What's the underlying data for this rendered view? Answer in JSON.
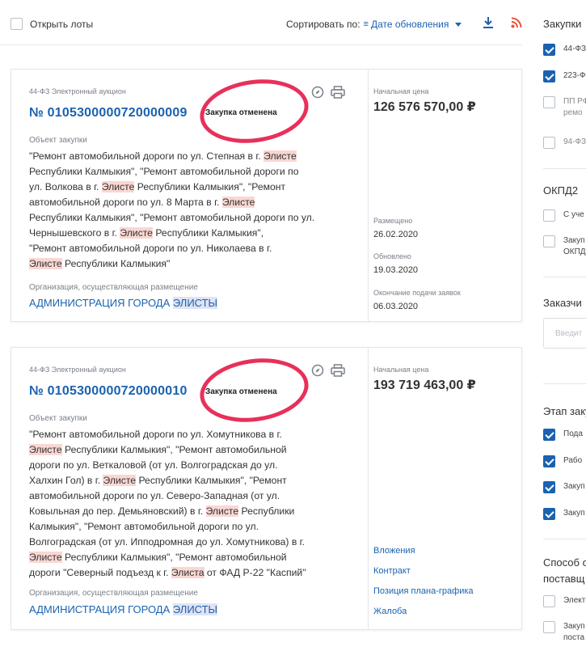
{
  "toolbar": {
    "open_lots": "Открыть лоты",
    "sort_label": "Сортировать по:",
    "sort_value": "Дате обновления",
    "download_icon": "download-icon",
    "rss_icon": "rss-icon"
  },
  "cards": [
    {
      "type": "44-ФЗ Электронный аукцион",
      "number": "№ 0105300000720000009",
      "status": "Закупка отменена",
      "object_label": "Объект закупки",
      "object_parts": [
        "\"Ремонт  автомобильной дороги по ул. Степная в г. ",
        "Элисте",
        "",
        "Республики Калмыкия\", \"Ремонт автомобильной дороги по",
        "",
        "",
        "ул. Волкова в г. ",
        "Элисте",
        " Республики Калмыкия\", \"Ремонт",
        "автомобильной дороги по ул. 8 Марта в г. ",
        "Элисте",
        "",
        "Республики Калмыкия\", \"Ремонт автомобильной дороги по ул.",
        "",
        "",
        "Чернышевского в г. ",
        "Элисте",
        " Республики Калмыкия\",",
        "\"Ремонт автомобильной дороги по ул. Николаева в г.",
        "",
        "",
        "",
        "Элисте",
        " Республики Калмыкия\""
      ],
      "org_label": "Организация, осуществляющая размещение",
      "org_prefix": "АДМИНИСТРАЦИЯ ГОРОДА ",
      "org_hl": "ЭЛИСТЫ",
      "price_label": "Начальная цена",
      "price": "126 576 570,00 ₽",
      "placed_label": "Размещено",
      "placed": "26.02.2020",
      "updated_label": "Обновлено",
      "updated": "19.03.2020",
      "deadline_label": "Окончание подачи заявок",
      "deadline": "06.03.2020"
    },
    {
      "type": "44-ФЗ Электронный аукцион",
      "number": "№ 0105300000720000010",
      "status": "Закупка отменена",
      "object_label": "Объект закупки",
      "object_parts": [
        "\"Ремонт автомобильной дороги по ул. Хомутникова в г.",
        "",
        "",
        "",
        "Элисте",
        " Республики Калмыкия\", \"Ремонт автомобильной",
        "дороги по ул. Веткаловой (от ул. Волгоградская до ул.",
        "",
        "",
        "Халхин Гол) в г. ",
        "Элисте",
        " Республики Калмыкия\", \"Ремонт",
        "автомобильной дороги по ул. Северо-Западная (от ул.",
        "",
        "",
        "Ковыльная до пер. Демьяновский) в г. ",
        "Элисте",
        " Республики",
        "Калмыкия\", \"Ремонт автомобильной дороги по ул.",
        "",
        "",
        "Волгоградская (от ул. Ипподромная до ул. Хомутникова) в г.",
        "",
        "",
        "",
        "Элисте",
        " Республики Калмыкия\", \"Ремонт автомобильной",
        "дороги \"Северный подъезд к г. ",
        "Элиста",
        " от ФАД Р-22 \"Каспий\""
      ],
      "org_label": "Организация, осуществляющая размещение",
      "org_prefix": "АДМИНИСТРАЦИЯ ГОРОДА ",
      "org_hl": "ЭЛИСТЫ",
      "price_label": "Начальная цена",
      "price": "193 719 463,00 ₽",
      "links": [
        "Вложения",
        "Контракт",
        "Позиция плана-графика",
        "Жалоба"
      ]
    }
  ],
  "filters": {
    "purchases_title": "Закупки",
    "purchases_items": [
      {
        "label": "44-ФЗ",
        "checked": true
      },
      {
        "label": "223-Ф",
        "checked": true
      },
      {
        "label": "ПП РФ",
        "line2": "ремо",
        "checked": false
      },
      {
        "label": "94-ФЗ",
        "checked": false
      }
    ],
    "okpd_title": "ОКПД2",
    "okpd_items": [
      {
        "label": "С уче",
        "checked": false
      },
      {
        "label": "Закуп",
        "line2": "ОКПД",
        "checked": false
      }
    ],
    "customer_title": "Заказчи",
    "customer_placeholder": "Введит",
    "stage_title": "Этап заку",
    "stage_items": [
      {
        "label": "Пода",
        "checked": true
      },
      {
        "label": "Рабо",
        "checked": true
      },
      {
        "label": "Закуп",
        "checked": true
      },
      {
        "label": "Закуп",
        "checked": true
      }
    ],
    "method_title": "Способ о",
    "method_title2": "поставщ",
    "method_items": [
      {
        "label": "Элект",
        "checked": false
      },
      {
        "label": "Закуп",
        "line2": "поста",
        "checked": false
      }
    ]
  }
}
